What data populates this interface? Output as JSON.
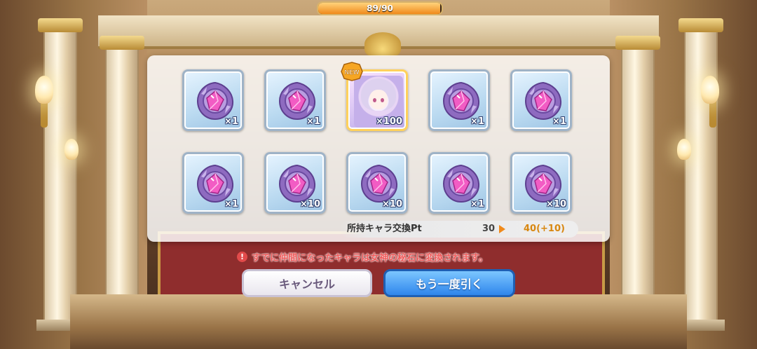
{
  "hud": {
    "stamina_text": "89/90",
    "stamina_fraction": 0.989
  },
  "results": [
    {
      "kind": "shard",
      "qty": "×1",
      "new": false
    },
    {
      "kind": "shard",
      "qty": "×1",
      "new": false
    },
    {
      "kind": "character",
      "qty": "×100",
      "new": true
    },
    {
      "kind": "shard",
      "qty": "×1",
      "new": false
    },
    {
      "kind": "shard",
      "qty": "×1",
      "new": false
    },
    {
      "kind": "shard",
      "qty": "×1",
      "new": false
    },
    {
      "kind": "shard",
      "qty": "×10",
      "new": false
    },
    {
      "kind": "shard",
      "qty": "×10",
      "new": false
    },
    {
      "kind": "shard",
      "qty": "×1",
      "new": false
    },
    {
      "kind": "shard",
      "qty": "×10",
      "new": false
    }
  ],
  "new_badge": "NEW",
  "points": {
    "label": "所持キャラ交換Pt",
    "old": "30",
    "new": "40(+10)"
  },
  "notice": "すでに仲間になったキャラは女神の秘石に変換されます。",
  "buttons": {
    "cancel": "キャンセル",
    "again": "もう一度引く"
  },
  "colors": {
    "accent_orange": "#f08a1b",
    "notice_red": "#ef5b5b",
    "primary_blue": "#2f86ec"
  }
}
